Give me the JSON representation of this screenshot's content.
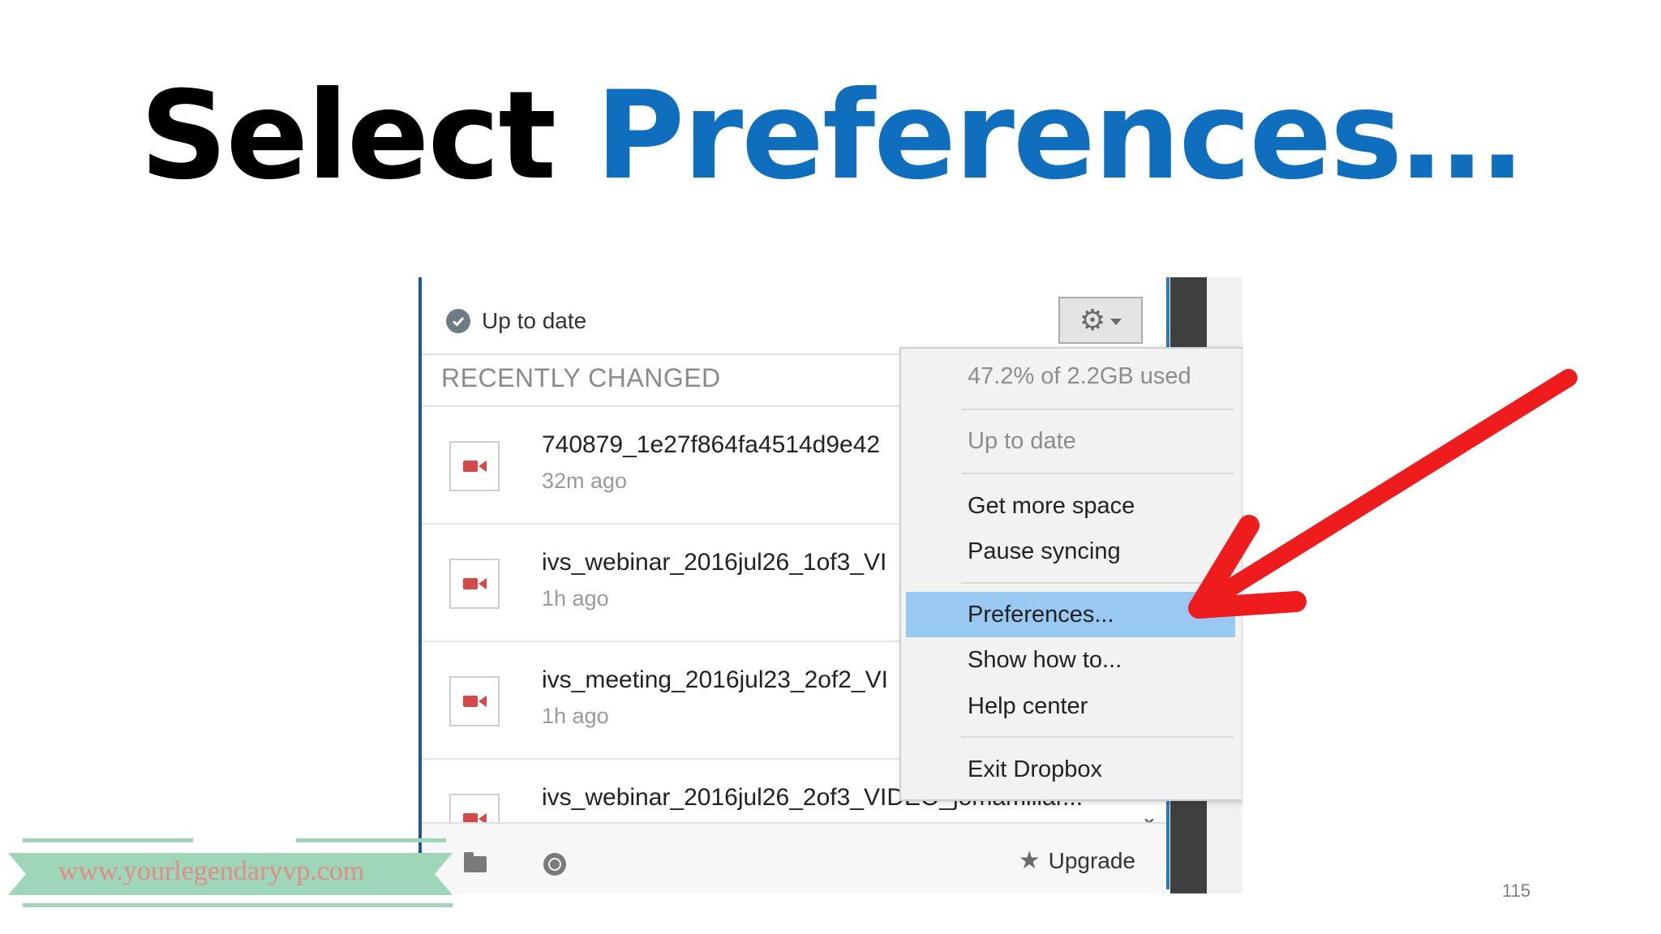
{
  "slide": {
    "title_part1": "Select",
    "title_part2": "Preferences…",
    "page_number": "115",
    "watermark": "www.yourlegendaryvp.com"
  },
  "dropbox": {
    "status": "Up to date",
    "section_header": "RECENTLY CHANGED",
    "gear_icon": "gear-icon",
    "files": [
      {
        "name": "740879_1e27f864fa4514d9e42",
        "time": "32m ago",
        "icon": "video-icon"
      },
      {
        "name": "ivs_webinar_2016jul26_1of3_VI",
        "time": "1h ago",
        "icon": "video-icon"
      },
      {
        "name": "ivs_meeting_2016jul23_2of2_VI",
        "time": "1h ago",
        "icon": "video-icon"
      },
      {
        "name": "ivs_webinar_2016jul26_2of3_VIDEO_jomamiliar...",
        "time": "",
        "icon": "video-icon"
      }
    ],
    "footer": {
      "upgrade_label": "Upgrade"
    },
    "menu": {
      "usage": "47.2% of 2.2GB used",
      "status": "Up to date",
      "get_more_space": "Get more space",
      "pause_syncing": "Pause syncing",
      "preferences": "Preferences...",
      "show_how_to": "Show how to...",
      "help_center": "Help center",
      "exit_dropbox": "Exit Dropbox"
    }
  },
  "colors": {
    "title_accent": "#0f6fbe",
    "highlight": "#99c9f3",
    "arrow": "#ee1c1c",
    "watermark_band": "#9ed6b9"
  }
}
